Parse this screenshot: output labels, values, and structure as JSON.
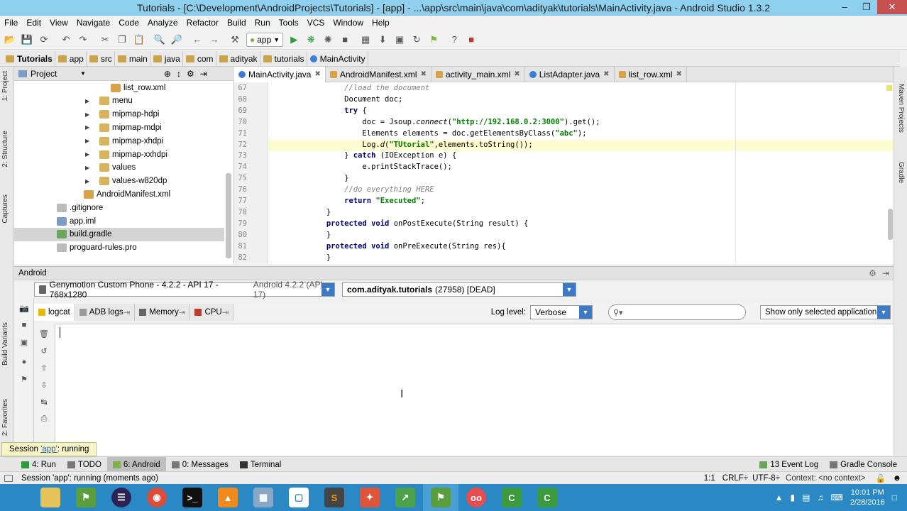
{
  "window": {
    "title": "Tutorials - [C:\\Development\\AndroidProjects\\Tutorials] - [app] - ...\\app\\src\\main\\java\\com\\adityak\\tutorials\\MainActivity.java - Android Studio 1.3.2",
    "min": "–",
    "max": "❐",
    "close": "✕"
  },
  "menu": [
    "File",
    "Edit",
    "View",
    "Navigate",
    "Code",
    "Analyze",
    "Refactor",
    "Build",
    "Run",
    "Tools",
    "VCS",
    "Window",
    "Help"
  ],
  "toolbar": {
    "run_config": "app"
  },
  "breadcrumb": [
    "Tutorials",
    "app",
    "src",
    "main",
    "java",
    "com",
    "adityak",
    "tutorials",
    "MainActivity"
  ],
  "project": {
    "header": "Project",
    "items": [
      {
        "label": "list_row.xml",
        "indent": 136,
        "arrow": "",
        "color": "#d8a24a"
      },
      {
        "label": "menu",
        "indent": 100,
        "arrow": "▶",
        "color": "#d6b35c"
      },
      {
        "label": "mipmap-hdpi",
        "indent": 100,
        "arrow": "▶",
        "color": "#d6b35c"
      },
      {
        "label": "mipmap-mdpi",
        "indent": 100,
        "arrow": "▶",
        "color": "#d6b35c"
      },
      {
        "label": "mipmap-xhdpi",
        "indent": 100,
        "arrow": "▶",
        "color": "#d6b35c"
      },
      {
        "label": "mipmap-xxhdpi",
        "indent": 100,
        "arrow": "▶",
        "color": "#d6b35c"
      },
      {
        "label": "values",
        "indent": 100,
        "arrow": "▶",
        "color": "#d6b35c"
      },
      {
        "label": "values-w820dp",
        "indent": 100,
        "arrow": "▶",
        "color": "#d6b35c"
      },
      {
        "label": "AndroidManifest.xml",
        "indent": 98,
        "arrow": "",
        "color": "#d8a24a"
      },
      {
        "label": ".gitignore",
        "indent": 60,
        "arrow": "",
        "color": "#bbbbbb"
      },
      {
        "label": "app.iml",
        "indent": 60,
        "arrow": "",
        "color": "#7a9bc4"
      },
      {
        "label": "build.gradle",
        "indent": 60,
        "arrow": "",
        "color": "#69a85c",
        "selected": true
      },
      {
        "label": "proguard-rules.pro",
        "indent": 60,
        "arrow": "",
        "color": "#bbbbbb"
      }
    ]
  },
  "tabs": [
    {
      "label": "MainActivity.java",
      "active": true,
      "color": "#3b7dd8"
    },
    {
      "label": "AndroidManifest.xml",
      "active": false,
      "color": "#d8a24a"
    },
    {
      "label": "activity_main.xml",
      "active": false,
      "color": "#d8a24a"
    },
    {
      "label": "ListAdapter.java",
      "active": false,
      "color": "#3b7dd8"
    },
    {
      "label": "list_row.xml",
      "active": false,
      "color": "#d8a24a"
    }
  ],
  "code": [
    {
      "n": "67",
      "segs": [
        [
          "cm",
          "                //load the document"
        ]
      ]
    },
    {
      "n": "68",
      "segs": [
        [
          "",
          "                Document doc;"
        ]
      ]
    },
    {
      "n": "69",
      "segs": [
        [
          "",
          "                "
        ],
        [
          "kw",
          "try"
        ],
        [
          "",
          " {"
        ]
      ]
    },
    {
      "n": "70",
      "segs": [
        [
          "",
          "                    doc = Jsoup."
        ],
        [
          "it",
          "connect"
        ],
        [
          "",
          "("
        ],
        [
          "str",
          "\"http://192.168.0.2:3000\""
        ],
        [
          "",
          ").get();"
        ]
      ]
    },
    {
      "n": "71",
      "segs": [
        [
          "",
          "                    Elements elements = doc.getElementsByClass("
        ],
        [
          "str",
          "\"abc\""
        ],
        [
          "",
          ");"
        ]
      ]
    },
    {
      "n": "72",
      "segs": [
        [
          "",
          "                    Log."
        ],
        [
          "it",
          "d"
        ],
        [
          "",
          "("
        ],
        [
          "str",
          "\"TUtorial\""
        ],
        [
          "",
          ",elements.toString());"
        ]
      ],
      "hl": true
    },
    {
      "n": "73",
      "segs": [
        [
          "",
          "                } "
        ],
        [
          "kw",
          "catch"
        ],
        [
          "",
          " (IOException e) {"
        ]
      ]
    },
    {
      "n": "74",
      "segs": [
        [
          "",
          "                    e.printStackTrace();"
        ]
      ]
    },
    {
      "n": "75",
      "segs": [
        [
          "",
          "                }"
        ]
      ]
    },
    {
      "n": "76",
      "segs": [
        [
          "cm",
          "                //do everything HERE"
        ]
      ]
    },
    {
      "n": "77",
      "segs": [
        [
          "",
          "                "
        ],
        [
          "kw",
          "return"
        ],
        [
          "",
          ""
        ],
        [
          "str",
          " \"Executed\""
        ],
        [
          "",
          ";"
        ]
      ]
    },
    {
      "n": "78",
      "segs": [
        [
          "",
          "            }"
        ]
      ]
    },
    {
      "n": "79",
      "segs": [
        [
          "",
          "            "
        ],
        [
          "kw",
          "protected void"
        ],
        [
          "",
          " onPostExecute(String result) {"
        ]
      ]
    },
    {
      "n": "80",
      "segs": [
        [
          "",
          "            }"
        ]
      ]
    },
    {
      "n": "81",
      "segs": [
        [
          "",
          "            "
        ],
        [
          "kw",
          "protected void"
        ],
        [
          "",
          " onPreExecute(String res){"
        ]
      ]
    },
    {
      "n": "82",
      "segs": [
        [
          "",
          "            }"
        ]
      ]
    }
  ],
  "android_panel": {
    "title": "Android",
    "device": "Genymotion Custom Phone - 4.2.2 - API 17 - 768x1280",
    "device_suffix": "Android 4.2.2 (API 17)",
    "process": "com.adityak.tutorials",
    "process_suffix": "(27958) [DEAD]",
    "tabs": [
      "logcat",
      "ADB logs",
      "Memory",
      "CPU"
    ],
    "log_level_label": "Log level:",
    "log_level": "Verbose",
    "search_placeholder": "",
    "filter": "Show only selected application"
  },
  "session_popup": {
    "prefix": "Session ",
    "link": "'app'",
    "suffix": ": running"
  },
  "bottom_tabs": {
    "left": [
      {
        "label": "4: Run",
        "active": false
      },
      {
        "label": "TODO",
        "active": false
      },
      {
        "label": "6: Android",
        "active": true
      },
      {
        "label": "0: Messages",
        "active": false
      },
      {
        "label": "Terminal",
        "active": false
      }
    ],
    "right": [
      {
        "label": "13 Event Log"
      },
      {
        "label": "Gradle Console"
      }
    ]
  },
  "status": {
    "message": "Session 'app': running (moments ago)",
    "position": "1:1",
    "line_sep": "CRLF÷",
    "encoding": "UTF-8÷",
    "context": "Context: <no context>"
  },
  "left_strip": [
    "1: Project",
    "2: Structure",
    "Captures",
    "Build Variants",
    "2: Favorites"
  ],
  "right_strip": [
    "Maven Projects",
    "Gradle"
  ],
  "clock": {
    "time": "10:01 PM",
    "date": "2/28/2016"
  }
}
